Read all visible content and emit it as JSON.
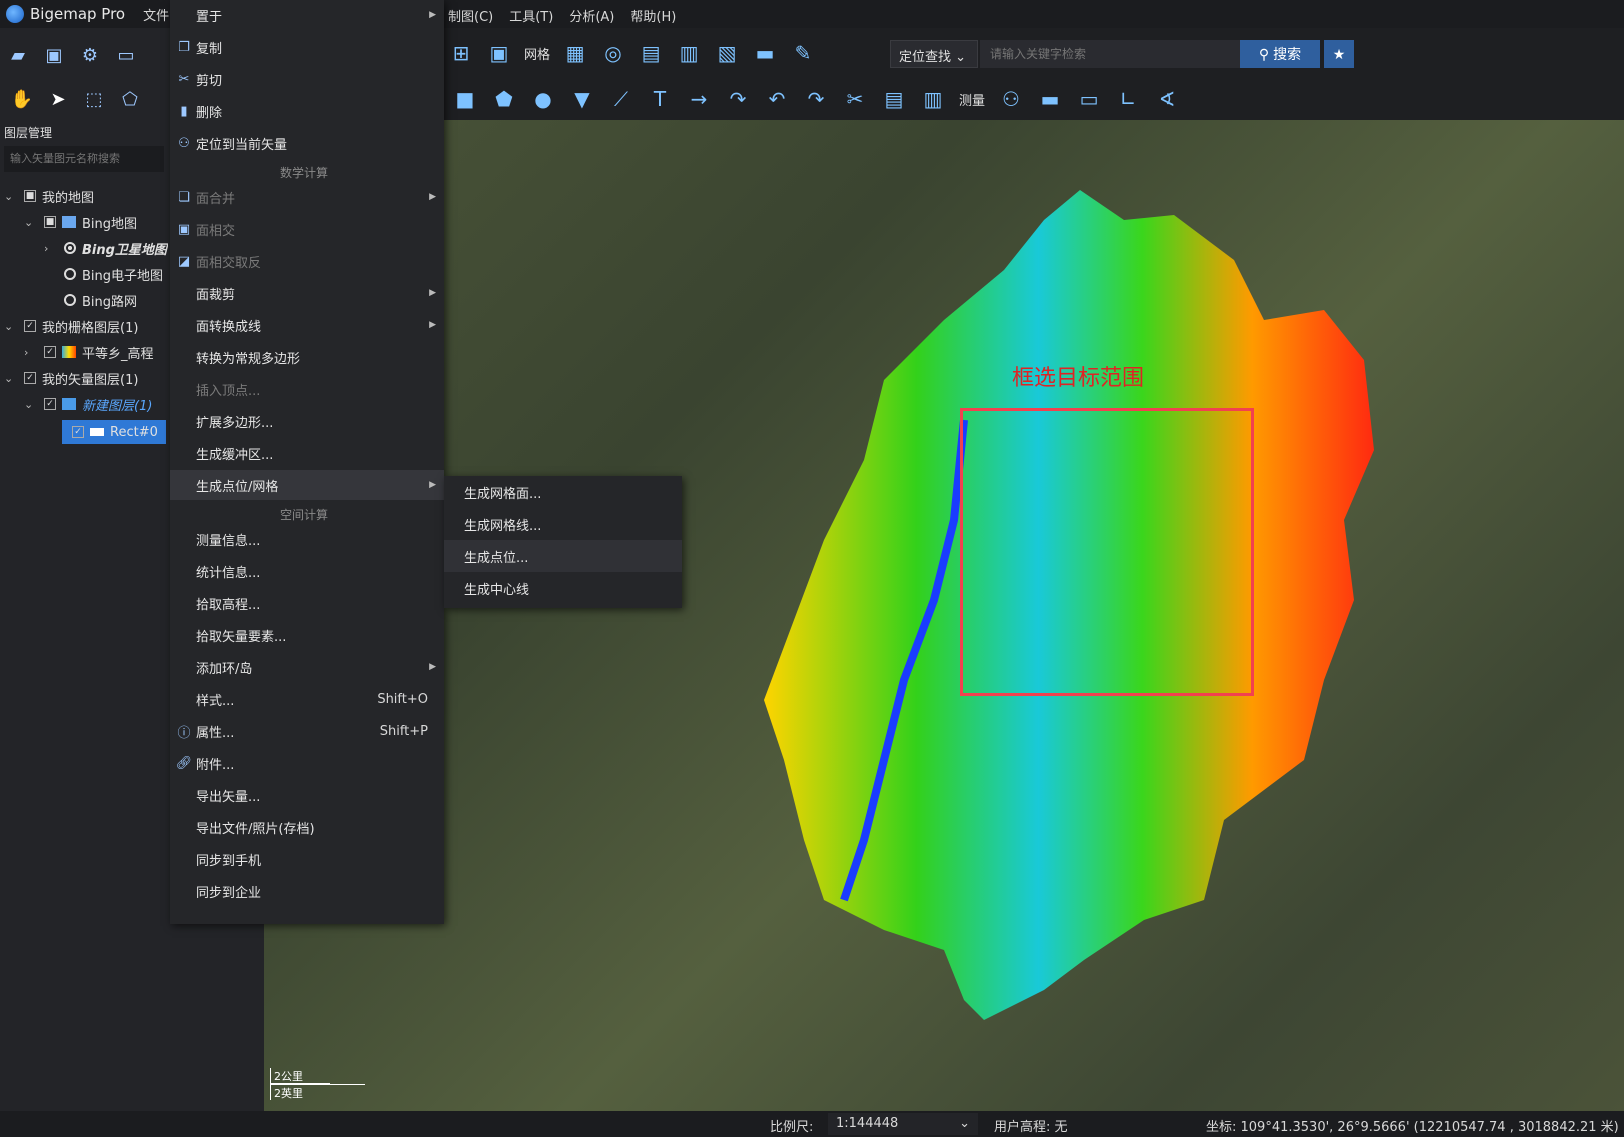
{
  "app": {
    "name": "Bigemap Pro"
  },
  "menubar": {
    "file": "文件",
    "extra": [
      "制图(C)",
      "工具(T)",
      "分析(A)",
      "帮助(H)"
    ]
  },
  "layer_panel": {
    "title": "图层管理",
    "search_placeholder": "输入矢量图元名称搜索",
    "tree": [
      {
        "label": "我的地图"
      },
      {
        "label": "Bing地图"
      },
      {
        "label": "Bing卫星地图"
      },
      {
        "label": "Bing电子地图"
      },
      {
        "label": "Bing路网"
      },
      {
        "label": "我的栅格图层(1)"
      },
      {
        "label": "平等乡_高程"
      },
      {
        "label": "我的矢量图层(1)"
      },
      {
        "label": "新建图层(1)"
      },
      {
        "label": "Rect#0"
      }
    ]
  },
  "toolbar": {
    "grid_label": "网格",
    "measure_label": "测量",
    "locate_select": "定位查找",
    "search_placeholder": "请输入关键字检索",
    "search_button": "搜索"
  },
  "context_menu": {
    "items": [
      {
        "label": "置于",
        "arrow": true
      },
      {
        "label": "复制"
      },
      {
        "label": "剪切"
      },
      {
        "label": "删除"
      },
      {
        "label": "定位到当前矢量"
      },
      {
        "label": "面合并",
        "disabled": true
      },
      {
        "label": "面相交",
        "disabled": true
      },
      {
        "label": "面相交取反",
        "disabled": true
      },
      {
        "label": "面裁剪"
      },
      {
        "label": "面转换成线"
      },
      {
        "label": "转换为常规多边形"
      },
      {
        "label": "插入顶点...",
        "disabled": true
      },
      {
        "label": "扩展多边形..."
      },
      {
        "label": "生成缓冲区..."
      },
      {
        "label": "生成点位/网格"
      },
      {
        "label": "测量信息..."
      },
      {
        "label": "统计信息..."
      },
      {
        "label": "拾取高程..."
      },
      {
        "label": "拾取矢量要素..."
      },
      {
        "label": "添加环/岛"
      },
      {
        "label": "样式..."
      },
      {
        "label": "属性..."
      },
      {
        "label": "附件..."
      },
      {
        "label": "导出矢量..."
      },
      {
        "label": "导出文件/照片(存档)"
      },
      {
        "label": "同步到手机"
      },
      {
        "label": "同步到企业"
      }
    ],
    "section_math": "数学计算",
    "section_space": "空间计算",
    "shortcut_style": "Shift+O",
    "shortcut_props": "Shift+P"
  },
  "submenu": {
    "items": [
      "生成网格面...",
      "生成网格线...",
      "生成点位...",
      "生成中心线"
    ]
  },
  "map": {
    "annotation": "框选目标范围",
    "scale_km": "2公里",
    "scale_mi": "2英里"
  },
  "statusbar": {
    "scale_label": "比例尺:",
    "scale_value": "1:144448",
    "elevation": "用户高程: 无",
    "coordinate": "坐标: 109°41.3530', 26°9.5666' (12210547.74 , 3018842.21 米)"
  },
  "colors": {
    "accent": "#2f79d6",
    "highlight_red": "#f2414f"
  }
}
